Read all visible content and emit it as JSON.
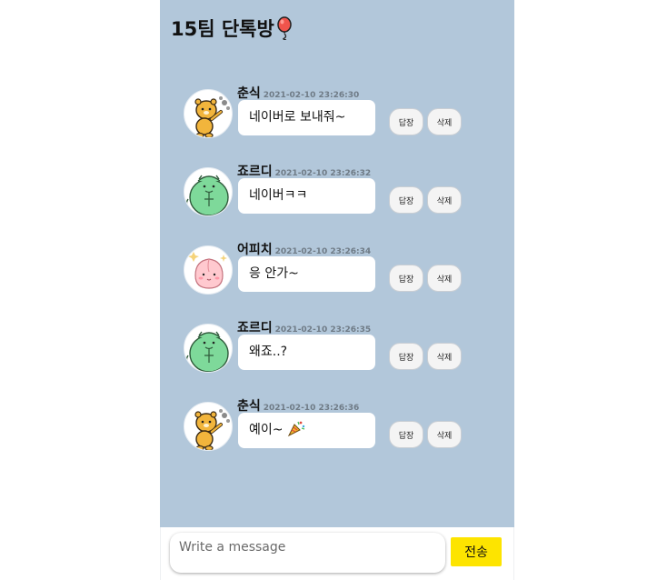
{
  "room": {
    "title": "15팀 단톡방"
  },
  "buttons": {
    "reply_label": "답장",
    "delete_label": "삭제"
  },
  "messages": [
    {
      "sender": "춘식",
      "time": "2021-02-10 23:26:30",
      "text": "네이버로 보내줘~",
      "avatar": "chunsik-avatar"
    },
    {
      "sender": "죠르디",
      "time": "2021-02-10 23:26:32",
      "text": "네이버ㅋㅋ",
      "avatar": "jordy-avatar"
    },
    {
      "sender": "어피치",
      "time": "2021-02-10 23:26:34",
      "text": "응 안가~",
      "avatar": "apeach-avatar"
    },
    {
      "sender": "죠르디",
      "time": "2021-02-10 23:26:35",
      "text": "왜죠..?",
      "avatar": "jordy-avatar"
    },
    {
      "sender": "춘식",
      "time": "2021-02-10 23:26:36",
      "text": "예이~",
      "avatar": "chunsik-avatar",
      "emoji_icon": "party-popper-icon"
    }
  ],
  "composer": {
    "placeholder": "Write a message",
    "value": "",
    "send_label": "전송"
  },
  "colors": {
    "background": "#b2c7da",
    "send_button": "#fde400",
    "bubble": "#ffffff"
  }
}
